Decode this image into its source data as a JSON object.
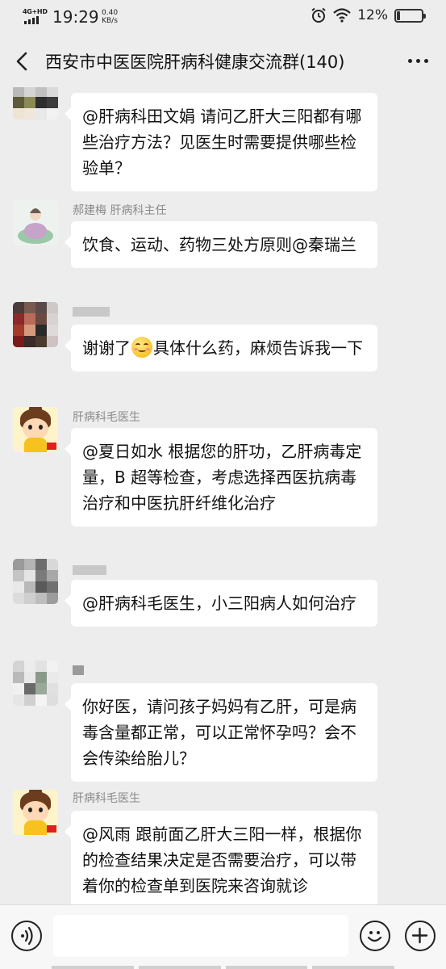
{
  "status_bar": {
    "network": "4G+HD",
    "time": "19:29",
    "speed_value": "0.40",
    "speed_unit": "KB/s",
    "battery": "12%",
    "battery_level": 0.12
  },
  "nav": {
    "title": "西安市中医医院肝病科健康交流群(140)"
  },
  "messages": [
    {
      "sender": "",
      "avatar": "mosaic-dark",
      "text": "@肝病科田文娟  请问乙肝大三阳都有哪些治疗方法？见医生时需要提供哪些检验单？"
    },
    {
      "sender": "郝建梅 肝病科主任",
      "avatar": "photo",
      "text": "饮食、运动、药物三处方原则@秦瑞兰"
    },
    {
      "sender": "",
      "avatar": "mosaic-red",
      "text_before": "谢谢了",
      "emoji": "smile-emoji",
      "text_after": "具体什么药，麻烦告诉我一下"
    },
    {
      "sender": "肝病科毛医生",
      "avatar": "cartoon",
      "text": "@夏日如水   根据您的肝功，乙肝病毒定量，B 超等检查，考虑选择西医抗病毒治疗和中医抗肝纤维化治疗"
    },
    {
      "sender": "",
      "avatar": "mosaic-gray",
      "text": "@肝病科毛医生，小三阳病人如何治疗"
    },
    {
      "sender": "",
      "avatar": "mosaic-light",
      "text": "你好医，请问孩子妈妈有乙肝，可是病毒含量都正常，可以正常怀孕吗？会不会传染给胎儿？"
    },
    {
      "sender": "肝病科毛医生",
      "avatar": "cartoon",
      "text": "@风雨   跟前面乙肝大三阳一样，根据你的检查结果决定是否需要治疗，可以带着你的检查单到医院来咨询就诊"
    }
  ],
  "input": {
    "placeholder": ""
  }
}
